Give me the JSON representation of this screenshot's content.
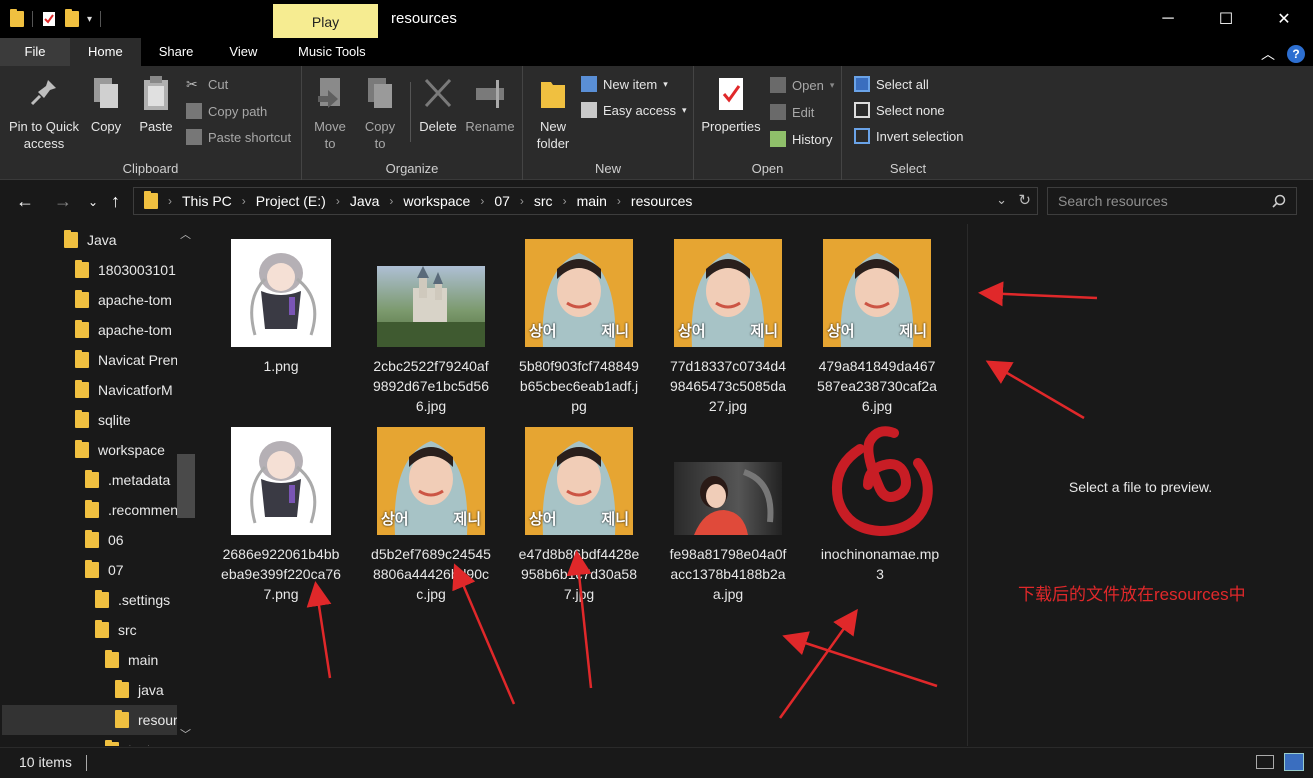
{
  "title_bar": {
    "window_title": "resources",
    "context_tab": "Play"
  },
  "tabs": [
    "File",
    "Home",
    "Share",
    "View",
    "Music Tools"
  ],
  "ribbon": {
    "clipboard": {
      "pin": "Pin to Quick access",
      "copy": "Copy",
      "paste": "Paste",
      "cut": "Cut",
      "copy_path": "Copy path",
      "paste_shortcut": "Paste shortcut",
      "label": "Clipboard"
    },
    "organize": {
      "move_to": "Move to",
      "copy_to": "Copy to",
      "delete": "Delete",
      "rename": "Rename",
      "label": "Organize"
    },
    "new": {
      "new_folder": "New folder",
      "new_item": "New item",
      "easy_access": "Easy access",
      "label": "New"
    },
    "open": {
      "properties": "Properties",
      "open": "Open",
      "edit": "Edit",
      "history": "History",
      "label": "Open"
    },
    "select": {
      "select_all": "Select all",
      "select_none": "Select none",
      "invert": "Invert selection",
      "label": "Select"
    }
  },
  "breadcrumb": [
    "This PC",
    "Project (E:)",
    "Java",
    "workspace",
    "07",
    "src",
    "main",
    "resources"
  ],
  "search": {
    "placeholder": "Search resources"
  },
  "nav_tree": [
    "Java",
    "1803003101",
    "apache-tom",
    "apache-tom",
    "Navicat Pren",
    "NavicatforM",
    "sqlite",
    "workspace",
    ".metadata",
    ".recommen",
    "06",
    "07",
    ".settings",
    "src",
    "main",
    "java",
    "resour",
    "test"
  ],
  "files": [
    {
      "name": "1.png",
      "kind": "anime"
    },
    {
      "name": "2cbc2522f79240af9892d67e1bc5d566.jpg",
      "kind": "castle"
    },
    {
      "name": "5b80f903fcf748849b65cbec6eab1adf.jpg",
      "kind": "portrait"
    },
    {
      "name": "77d18337c0734d498465473c5085da27.jpg",
      "kind": "portrait"
    },
    {
      "name": "479a841849da467587ea238730caf2a6.jpg",
      "kind": "portrait"
    },
    {
      "name": "2686e922061b4bbeba9e399f220ca767.png",
      "kind": "anime"
    },
    {
      "name": "d5b2ef7689c245458806a44426bd90cc.jpg",
      "kind": "portrait"
    },
    {
      "name": "e47d8b86bdf4428e958b6b1c7d30a587.jpg",
      "kind": "portrait"
    },
    {
      "name": "fe98a81798e04a0facc1378b4188b2aa.jpg",
      "kind": "car"
    },
    {
      "name": "inochinonamae.mp3",
      "kind": "music"
    }
  ],
  "thumb_caption": {
    "left": "상어",
    "right": "제니"
  },
  "preview": {
    "text": "Select a file to preview."
  },
  "annotation": "下载后的文件放在resources中",
  "status": {
    "items": "10 items"
  },
  "colors": {
    "accent_red": "#e0282a",
    "folder": "#f0c040",
    "play_tab": "#f6ec91"
  }
}
